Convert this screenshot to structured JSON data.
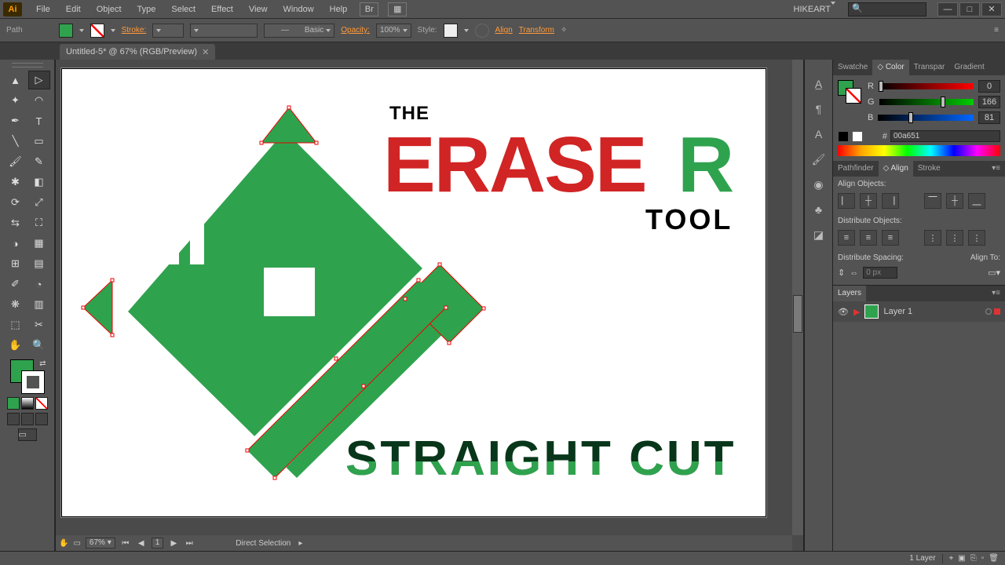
{
  "app": {
    "logo": "Ai"
  },
  "menu": [
    "File",
    "Edit",
    "Object",
    "Type",
    "Select",
    "Effect",
    "View",
    "Window",
    "Help"
  ],
  "user_menu": "HIKEART",
  "search_placeholder": "",
  "win": {
    "min": "—",
    "max": "□",
    "close": "✕"
  },
  "control": {
    "mode": "Path",
    "stroke_label": "Stroke:",
    "profile": "Basic",
    "opacity_label": "Opacity:",
    "opacity": "100%",
    "style_label": "Style:",
    "align": "Align",
    "transform": "Transform"
  },
  "document_tab": "Untitled-5* @ 67% (RGB/Preview)",
  "doc_close": "✕",
  "zoom": "67%",
  "page_number": "1",
  "selection_info": "Direct Selection",
  "artwork": {
    "the": "THE",
    "erase": "ERASE",
    "r": "R",
    "tool": "TOOL",
    "straight_cut": "STRAIGHT CUT"
  },
  "color": {
    "tabs": [
      "Swatches",
      "Color",
      "Transparency",
      "Gradient"
    ],
    "tabs_short": [
      "Swatche",
      "Color",
      "Transpar",
      "Gradient"
    ],
    "r_label": "R",
    "r": "0",
    "g_label": "G",
    "g": "166",
    "b_label": "B",
    "b": "81",
    "hex_prefix": "#",
    "hex": "00a651"
  },
  "align": {
    "tabs": [
      "Pathfinder",
      "Align",
      "Stroke"
    ],
    "section_align": "Align Objects:",
    "section_dist": "Distribute Objects:",
    "section_spacing": "Distribute Spacing:",
    "align_to": "Align To:",
    "spacing_value": "0 px"
  },
  "layers": {
    "tab": "Layers",
    "layer1": "Layer 1",
    "count": "1 Layer"
  },
  "colors": {
    "accent_green": "#2fa24e",
    "accent_red": "#d12424"
  }
}
